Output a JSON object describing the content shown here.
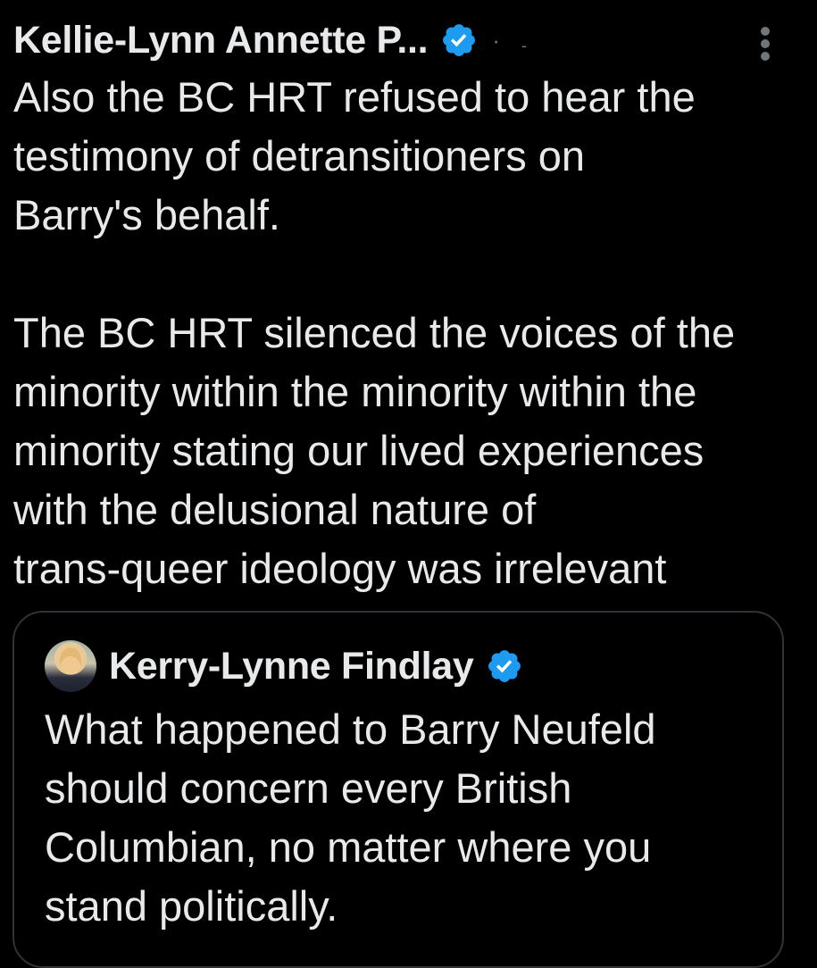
{
  "tweet": {
    "author_name": "Kellie-Lynn Annette P...",
    "separator": "·",
    "handle_stub": "-",
    "verified_icon": "verified-badge-icon",
    "more_icon": "more-vertical-icon",
    "paragraph_1": "Also the BC HRT refused to hear the\ntestimony of detransitioners on\nBarry's behalf.",
    "paragraph_2": "The BC HRT silenced the voices of the\nminority within the minority within the\nminority stating our lived experiences\nwith the delusional nature of\ntrans-queer ideology was irrelevant"
  },
  "quote": {
    "author_name": "Kerry-Lynne Findlay",
    "avatar_icon": "avatar",
    "verified_icon": "verified-badge-icon",
    "text": "What happened to Barry Neufeld\nshould concern every British\nColumbian, no matter where you\nstand politically."
  },
  "colors": {
    "background": "#000000",
    "text": "#e7e9ea",
    "secondary": "#71767b",
    "verified": "#1d9bf0",
    "border": "#2f3336"
  }
}
